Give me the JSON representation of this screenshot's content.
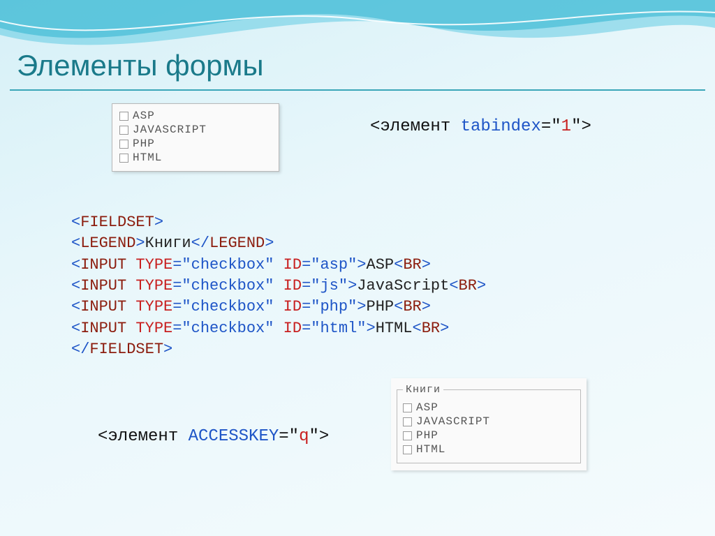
{
  "title": "Элементы формы",
  "checkbox_list": [
    "ASP",
    "JAVASCRIPT",
    "PHP",
    "HTML"
  ],
  "tabindex": {
    "prefix": "<элемент ",
    "attr": "tabindex",
    "eq_open": "=\"",
    "value": "1",
    "close": "\">"
  },
  "code": {
    "l1": {
      "open": "<",
      "tag": "FIELDSET",
      "close": ">"
    },
    "l2": {
      "open1": "<",
      "tag1": "LEGEND",
      "close1": ">",
      "text": "Книги",
      "open2": "</",
      "tag2": "LEGEND",
      "close2": ">"
    },
    "inputs": [
      {
        "open": "<",
        "tag": "INPUT",
        "sp": " ",
        "a1": "TYPE",
        "eq1": "=\"",
        "v1": "checkbox",
        "q1": "\" ",
        "a2": "ID",
        "eq2": "=\"",
        "v2": "asp",
        "q2": "\">",
        "label": "ASP",
        "br_open": "<",
        "br_tag": "BR",
        "br_close": ">"
      },
      {
        "open": "<",
        "tag": "INPUT",
        "sp": " ",
        "a1": "TYPE",
        "eq1": "=\"",
        "v1": "checkbox",
        "q1": "\" ",
        "a2": "ID",
        "eq2": "=\"",
        "v2": "js",
        "q2": "\">",
        "label": "JavaScript",
        "br_open": "<",
        "br_tag": "BR",
        "br_close": ">"
      },
      {
        "open": "<",
        "tag": "INPUT",
        "sp": " ",
        "a1": "TYPE",
        "eq1": "=\"",
        "v1": "checkbox",
        "q1": "\" ",
        "a2": "ID",
        "eq2": "=\"",
        "v2": "php",
        "q2": "\">",
        "label": "PHP",
        "br_open": "<",
        "br_tag": "BR",
        "br_close": ">"
      },
      {
        "open": "<",
        "tag": "INPUT",
        "sp": " ",
        "a1": "TYPE",
        "eq1": "=\"",
        "v1": "checkbox",
        "q1": "\" ",
        "a2": "ID",
        "eq2": "=\"",
        "v2": "html",
        "q2": "\">",
        "label": "HTML",
        "br_open": "<",
        "br_tag": "BR",
        "br_close": ">"
      }
    ],
    "l7": {
      "open": "</",
      "tag": "FIELDSET",
      "close": ">"
    }
  },
  "accesskey": {
    "prefix": "<элемент ",
    "attr": "ACCESSKEY",
    "eq_open": "=\"",
    "value": "q",
    "close": "\">"
  },
  "fieldset_render": {
    "legend": "Книги",
    "items": [
      "ASP",
      "JAVASCRIPT",
      "PHP",
      "HTML"
    ]
  }
}
